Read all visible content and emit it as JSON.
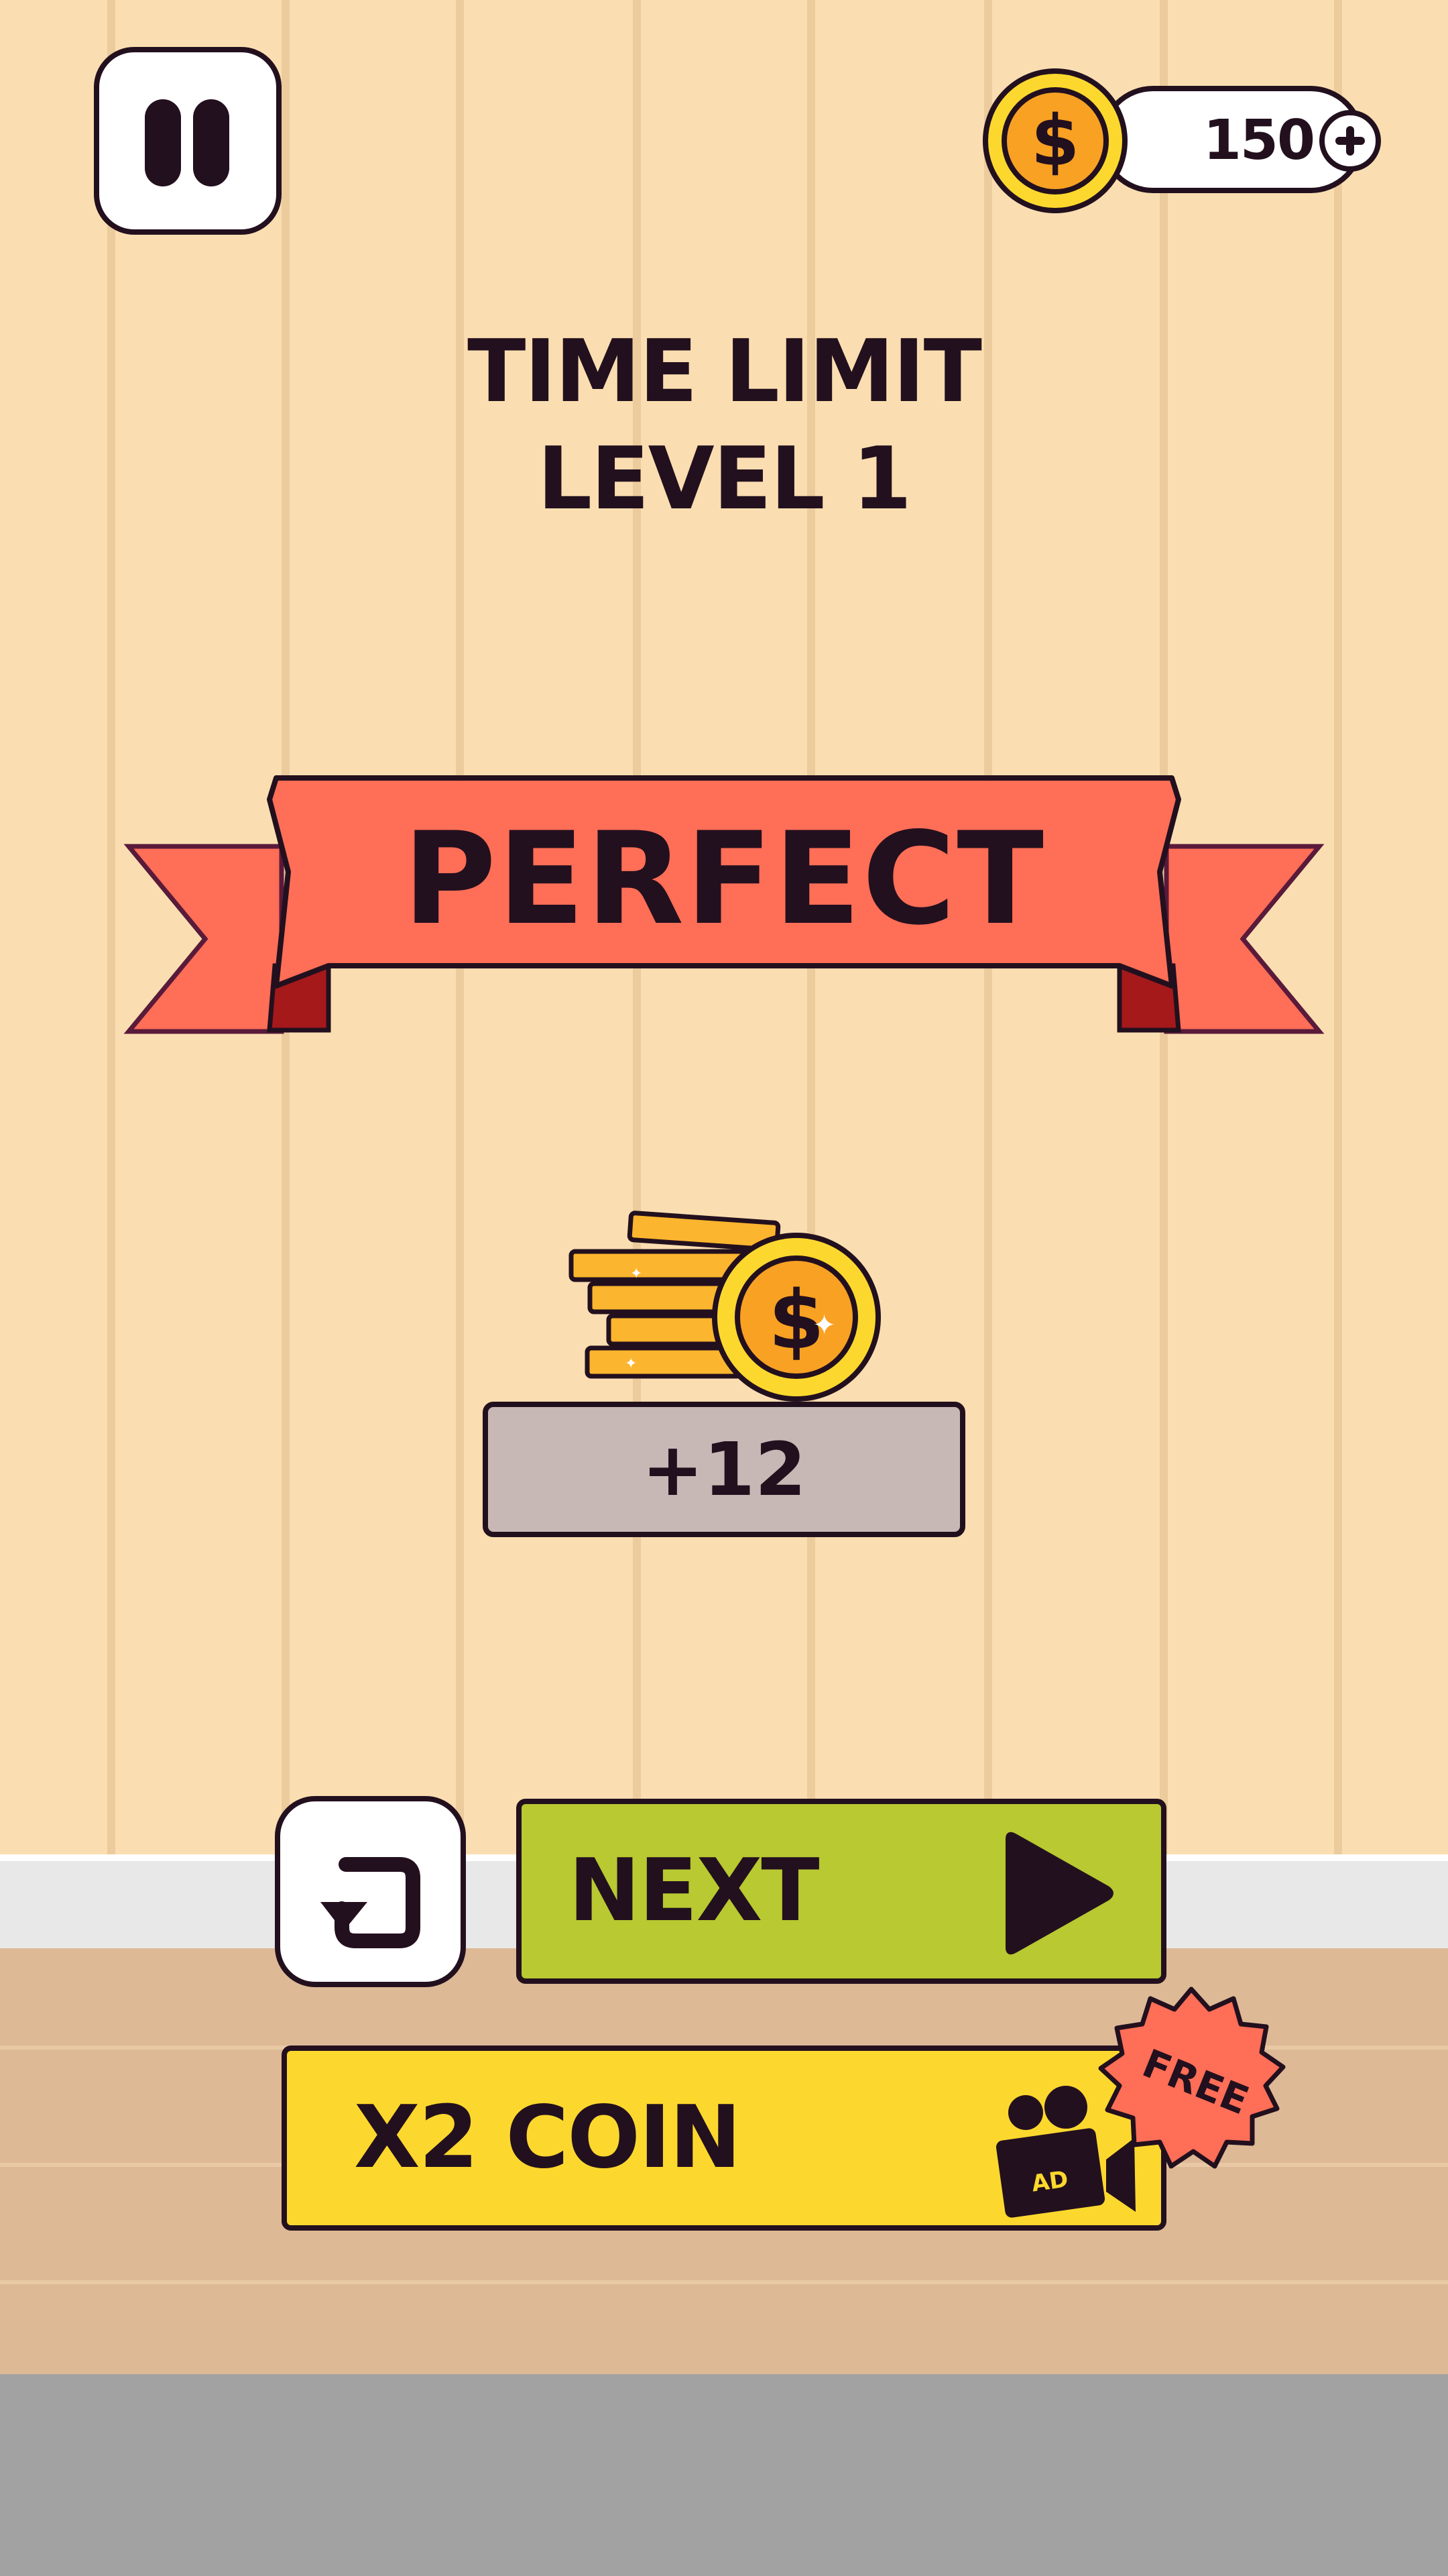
{
  "hud": {
    "pause_icon": "pause-icon",
    "coin_icon": "dollar-coin-icon",
    "coin_balance": "150",
    "add_coins_icon": "plus-icon"
  },
  "header": {
    "mode": "TIME LIMIT",
    "level": "LEVEL 1"
  },
  "result": {
    "rating": "PERFECT"
  },
  "reward": {
    "icon": "coin-stack-icon",
    "amount": "+12"
  },
  "actions": {
    "retry_icon": "retry-icon",
    "next_label": "NEXT",
    "next_icon": "play-icon",
    "double_label": "X2 COIN",
    "ad_icon": "video-camera-icon",
    "ad_label": "AD",
    "free_badge": "FREE"
  },
  "colors": {
    "outline": "#23101e",
    "background": "#fadeb1",
    "ribbon": "#ff6e57",
    "coin": "#f8a123",
    "next_button": "#b8c931",
    "x2_button": "#fcd82e",
    "reward_box": "#c7b7b5"
  }
}
